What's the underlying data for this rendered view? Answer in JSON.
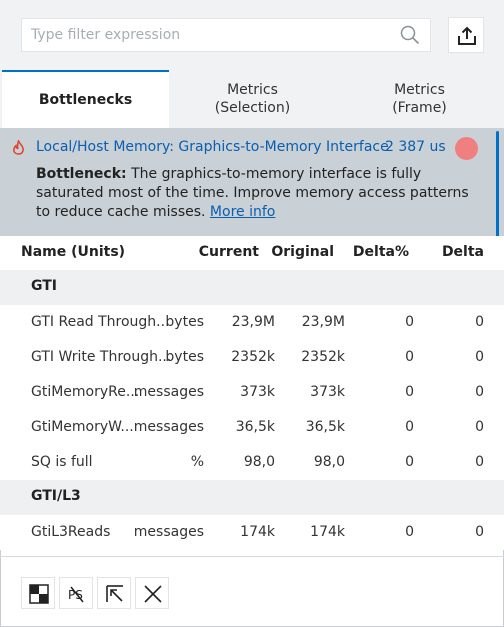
{
  "search": {
    "placeholder": "Type filter expression"
  },
  "tabs": [
    {
      "label": "Bottlenecks",
      "active": true
    },
    {
      "label": "Metrics\n(Selection)",
      "active": false
    },
    {
      "label": "Metrics\n(Frame)",
      "active": false
    }
  ],
  "bottleneck": {
    "title": "Local/Host Memory: Graphics-to-Memory Interface",
    "time": "2 387 us",
    "label": "Bottleneck:",
    "description": " The graphics-to-memory interface is fully saturated most of the time. Improve memory access patterns to reduce cache misses. ",
    "link": "More info",
    "indicator_color": "#f08080"
  },
  "table": {
    "headers": {
      "name": "Name (Units)",
      "current": "Current",
      "original": "Original",
      "delta_pct": "Delta%",
      "delta": "Delta"
    },
    "groups": [
      {
        "name": "GTI",
        "rows": [
          {
            "name": "GTI Read Through...",
            "unit": "bytes",
            "current": "23,9M",
            "original": "23,9M",
            "delta_pct": "0",
            "delta": "0"
          },
          {
            "name": "GTI Write Through...",
            "unit": "bytes",
            "current": "2352k",
            "original": "2352k",
            "delta_pct": "0",
            "delta": "0"
          },
          {
            "name": "GtiMemoryRe...",
            "unit": "messages",
            "current": "373k",
            "original": "373k",
            "delta_pct": "0",
            "delta": "0"
          },
          {
            "name": "GtiMemoryW...",
            "unit": "messages",
            "current": "36,5k",
            "original": "36,5k",
            "delta_pct": "0",
            "delta": "0"
          },
          {
            "name": "SQ is full",
            "unit": "%",
            "current": "98,0",
            "original": "98,0",
            "delta_pct": "0",
            "delta": "0"
          }
        ]
      },
      {
        "name": "GTI/L3",
        "rows": [
          {
            "name": "GtiL3Reads",
            "unit": "messages",
            "current": "174k",
            "original": "174k",
            "delta_pct": "0",
            "delta": "0"
          }
        ]
      }
    ]
  },
  "toolbar": {
    "buttons": [
      {
        "icon": "checker-icon"
      },
      {
        "icon": "ps-strikethrough-icon"
      },
      {
        "icon": "arrow-corner-icon"
      },
      {
        "icon": "close-icon"
      }
    ]
  },
  "colors": {
    "accent": "#0071c5",
    "link": "#0a5fb0",
    "banner": "#c9d0d6",
    "group_bg": "#eef0f2"
  }
}
